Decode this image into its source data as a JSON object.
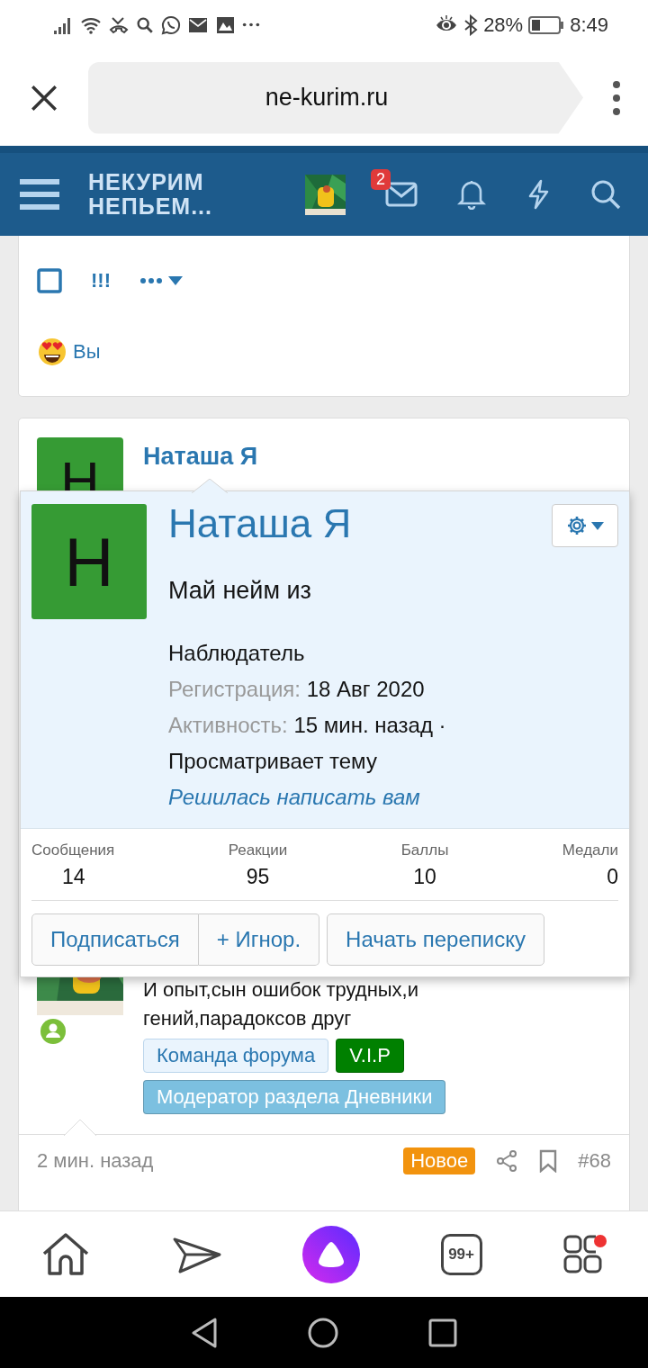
{
  "status_bar": {
    "battery": "28%",
    "time": "8:49"
  },
  "browser": {
    "url": "ne-kurim.ru"
  },
  "header": {
    "logo_lines": [
      "НЕКУРИМ",
      "НЕПЬЕМ..."
    ],
    "messages_badge": "2"
  },
  "reaction_card": {
    "actions": {
      "mark": "!!!"
    },
    "reactor": "Вы"
  },
  "post": {
    "author": "Наташа Я",
    "initial": "Н",
    "bio_lines": [
      "И опыт,сын ошибок трудных,и",
      "гений,парадоксов друг"
    ],
    "tags": [
      {
        "label": "Команда форума",
        "color": "#eaf4fd"
      },
      {
        "label": "V.I.P",
        "color": "#008000"
      },
      {
        "label": "Модератор раздела Дневники",
        "color": "#7cc0e0"
      }
    ],
    "time": "2 мин. назад",
    "new_badge": "Новое",
    "number": "#68"
  },
  "popup": {
    "initial": "Н",
    "name": "Наташа Я",
    "status": "Май нейм из",
    "role": "Наблюдатель",
    "registration_label": "Регистрация:",
    "registration_value": "18 Авг 2020",
    "activity_label": "Активность:",
    "activity_value": "15 мин. назад ·",
    "activity_text": "Просматривает тему",
    "activity_link": "Решилась написать вам",
    "stats": [
      {
        "label": "Сообщения",
        "value": "14"
      },
      {
        "label": "Реакции",
        "value": "95"
      },
      {
        "label": "Баллы",
        "value": "10"
      },
      {
        "label": "Медали",
        "value": "0"
      }
    ],
    "buttons": [
      "Подписаться",
      "+ Игнор.",
      "Начать переписку"
    ]
  },
  "bottom_nav": {
    "tabs_count": "99+"
  }
}
